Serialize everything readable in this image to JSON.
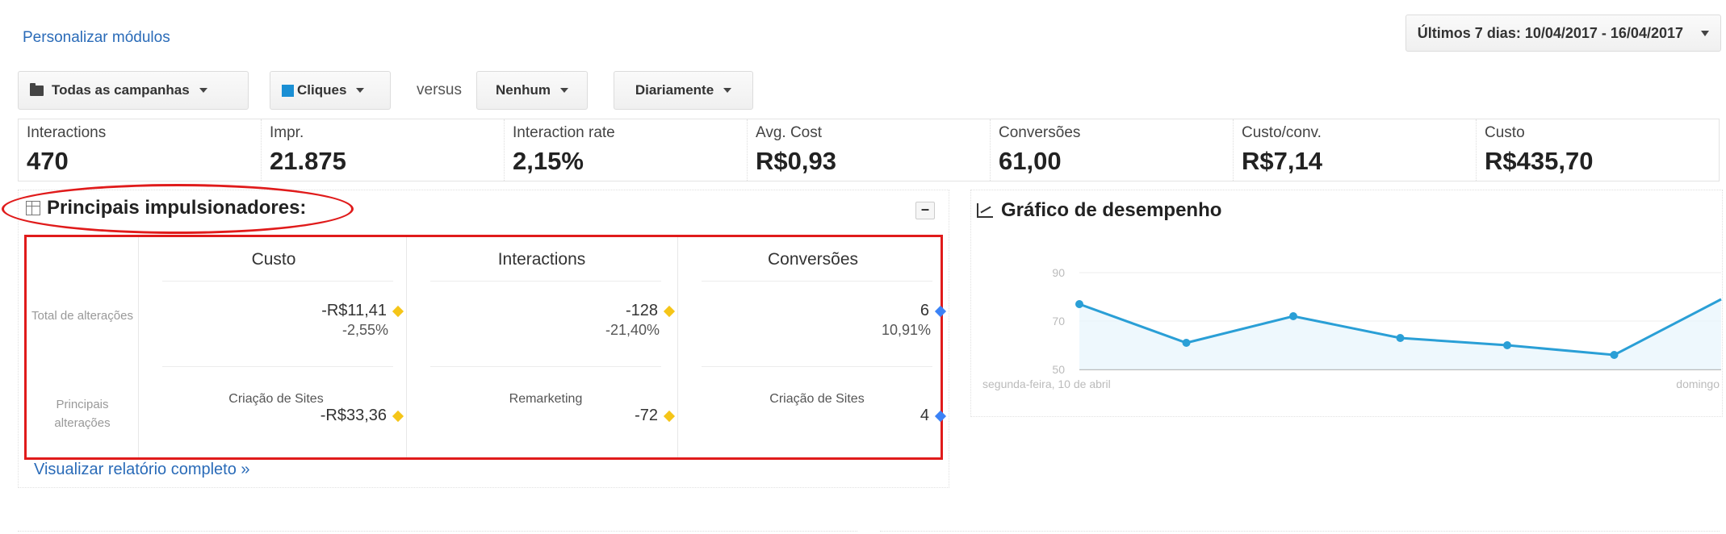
{
  "top": {
    "customize_link": "Personalizar módulos",
    "date_range": "Últimos 7 dias: 10/04/2017 - 16/04/2017"
  },
  "toolbar": {
    "campaigns": "Todas as campanhas",
    "metric": "Cliques",
    "metric_color": "#1a8fd4",
    "versus": "versus",
    "compare": "Nenhum",
    "granularity": "Diariamente"
  },
  "metrics": [
    {
      "label": "Interactions",
      "value": "470"
    },
    {
      "label": "Impr.",
      "value": "21.875"
    },
    {
      "label": "Interaction rate",
      "value": "2,15%"
    },
    {
      "label": "Avg. Cost",
      "value": "R$0,93"
    },
    {
      "label": "Conversões",
      "value": "61,00"
    },
    {
      "label": "Custo/conv.",
      "value": "R$7,14"
    },
    {
      "label": "Custo",
      "value": "R$435,70"
    }
  ],
  "drivers": {
    "title": "Principais impulsionadores:",
    "collapse": "–",
    "columns": [
      "Custo",
      "Interactions",
      "Conversões"
    ],
    "row_total_label": "Total de alterações",
    "row_main_label": "Principais alterações",
    "totals": [
      {
        "value": "-R$11,41",
        "percent": "-2,55%",
        "marker": "yellow"
      },
      {
        "value": "-128",
        "percent": "-21,40%",
        "marker": "yellow"
      },
      {
        "value": "6",
        "percent": "10,91%",
        "marker": "blue"
      }
    ],
    "main": [
      {
        "name": "Criação de Sites",
        "value": "-R$33,36",
        "marker": "yellow"
      },
      {
        "name": "Remarketing",
        "value": "-72",
        "marker": "yellow"
      },
      {
        "name": "Criação de Sites",
        "value": "4",
        "marker": "blue"
      }
    ],
    "full_report": "Visualizar relatório completo »",
    "highlight_color": "#e01b1b"
  },
  "performance": {
    "title": "Gráfico de desempenho"
  },
  "chart_data": {
    "type": "line",
    "title": "",
    "xlabel": "",
    "ylabel": "",
    "x": [
      "segunda-feira, 10 de abril",
      "",
      "",
      "",
      "",
      "",
      "domingo"
    ],
    "x_tick_labels": [
      "segunda-feira, 10 de abril",
      "domingo"
    ],
    "y_ticks": [
      50,
      70,
      90
    ],
    "ylim": [
      50,
      90
    ],
    "grid": true,
    "series": [
      {
        "values": [
          77,
          61,
          72,
          63,
          60,
          56,
          79
        ],
        "color": "#2a9fd6"
      }
    ]
  }
}
